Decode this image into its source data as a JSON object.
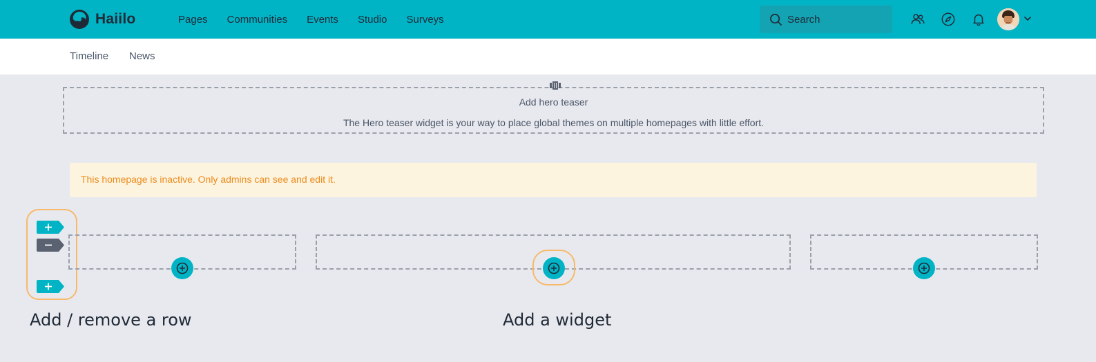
{
  "brand": {
    "name": "Haiilo"
  },
  "nav": {
    "items": [
      "Pages",
      "Communities",
      "Events",
      "Studio",
      "Surveys"
    ]
  },
  "search": {
    "placeholder": "Search"
  },
  "header_icons": [
    "people-icon",
    "compass-icon",
    "bell-icon"
  ],
  "subnav": {
    "items": [
      "Timeline",
      "News"
    ]
  },
  "hero": {
    "title": "Add hero teaser",
    "description": "The Hero teaser widget is your way to place global themes on multiple homepages with little effort."
  },
  "alert": {
    "text": "This homepage is inactive. Only admins can see and edit it."
  },
  "callouts": {
    "row": "Add / remove a row",
    "widget": "Add a widget"
  },
  "colors": {
    "accent": "#00b4c6",
    "highlight": "#f7b96a",
    "alert_bg": "#fcf4de",
    "alert_text": "#ec8a1c",
    "remove_button": "#5a6272"
  }
}
